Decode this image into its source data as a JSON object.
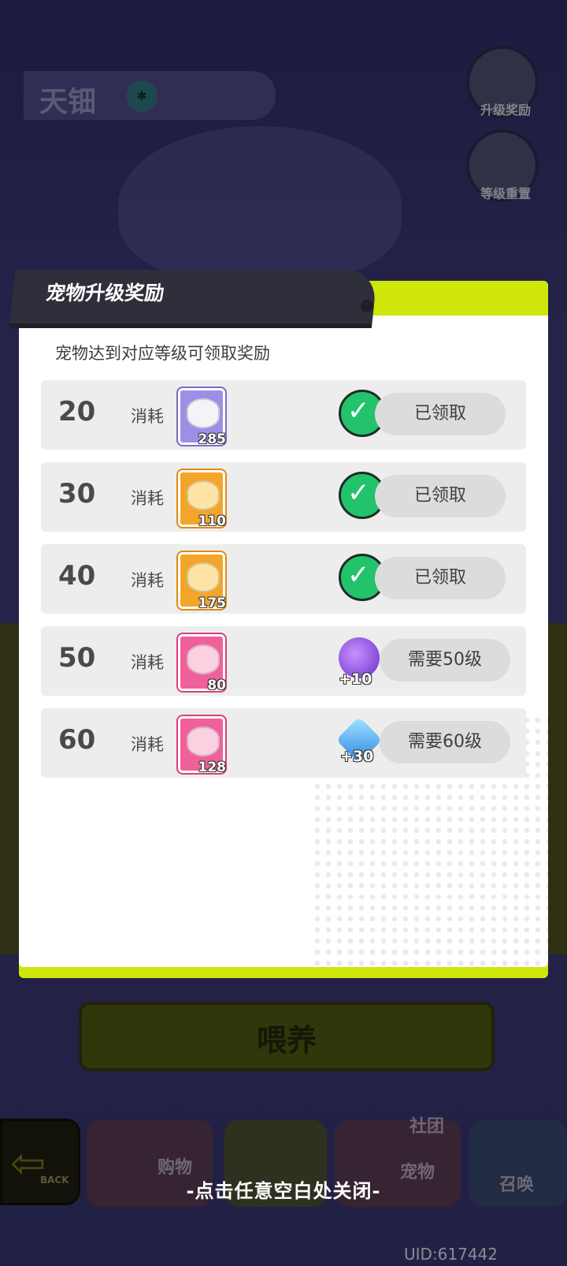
{
  "background": {
    "pet_name": "天钿",
    "pet_badge": "✱",
    "side_buttons": [
      "升级奖励",
      "等级重置"
    ],
    "feed_button": "喂养",
    "back_label": "BACK",
    "nav": [
      "购物",
      "社团",
      "宠物",
      "召唤"
    ],
    "uid": "UID:617442"
  },
  "modal": {
    "title": "宠物升级奖励",
    "subtitle": "宠物达到对应等级可领取奖励",
    "cost_label": "消耗",
    "rows": [
      {
        "level": "20",
        "can_qty": "285",
        "can_color": "#9b90e6",
        "reward_icon": "purple-orb-icon",
        "reward_amount": "",
        "status": "已领取",
        "claimed": true
      },
      {
        "level": "30",
        "can_qty": "110",
        "can_color": "#f3a52a",
        "reward_icon": "purple-orb-icon",
        "reward_amount": "",
        "status": "已领取",
        "claimed": true
      },
      {
        "level": "40",
        "can_qty": "175",
        "can_color": "#f3a52a",
        "reward_icon": "purple-orb-icon",
        "reward_amount": "",
        "status": "已领取",
        "claimed": true
      },
      {
        "level": "50",
        "can_qty": "80",
        "can_color": "#f0609a",
        "reward_icon": "purple-orb-icon",
        "reward_amount": "+10",
        "status": "需要50级",
        "claimed": false
      },
      {
        "level": "60",
        "can_qty": "128",
        "can_color": "#f0609a",
        "reward_icon": "blue-diamond-icon",
        "reward_amount": "+30",
        "status": "需要60级",
        "claimed": false
      }
    ]
  },
  "close_hint": "-点击任意空白处关闭-"
}
